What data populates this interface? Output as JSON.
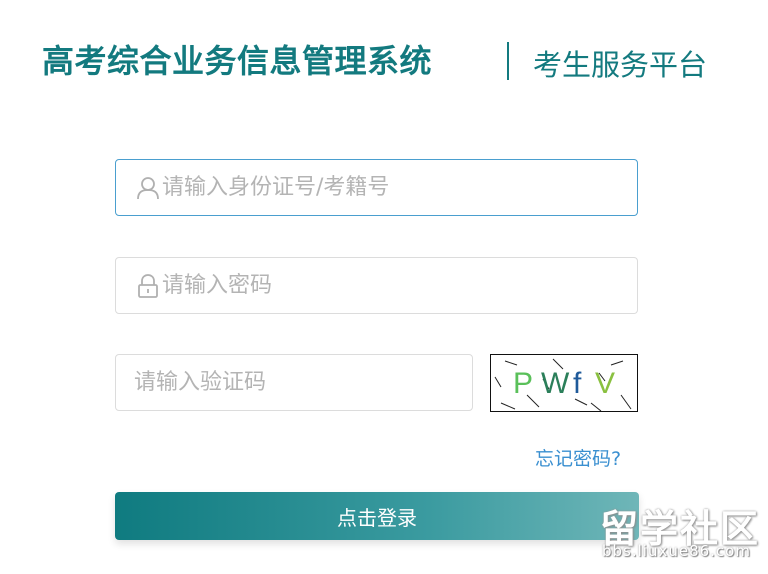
{
  "header": {
    "title": "高考综合业务信息管理系统",
    "subtitle": "考生服务平台"
  },
  "form": {
    "username_placeholder": "请输入身份证号/考籍号",
    "password_placeholder": "请输入密码",
    "captcha_placeholder": "请输入验证码",
    "captcha_text": "PWfV",
    "forgot_label": "忘记密码?",
    "login_label": "点击登录"
  },
  "watermark": {
    "text": "留学社区",
    "url": "bbs.liuxue86.com"
  },
  "colors": {
    "brand": "#137a7f",
    "focus_border": "#4a9fcf",
    "link": "#3a8fd0"
  },
  "icons": {
    "user": "user-icon",
    "lock": "lock-icon"
  }
}
